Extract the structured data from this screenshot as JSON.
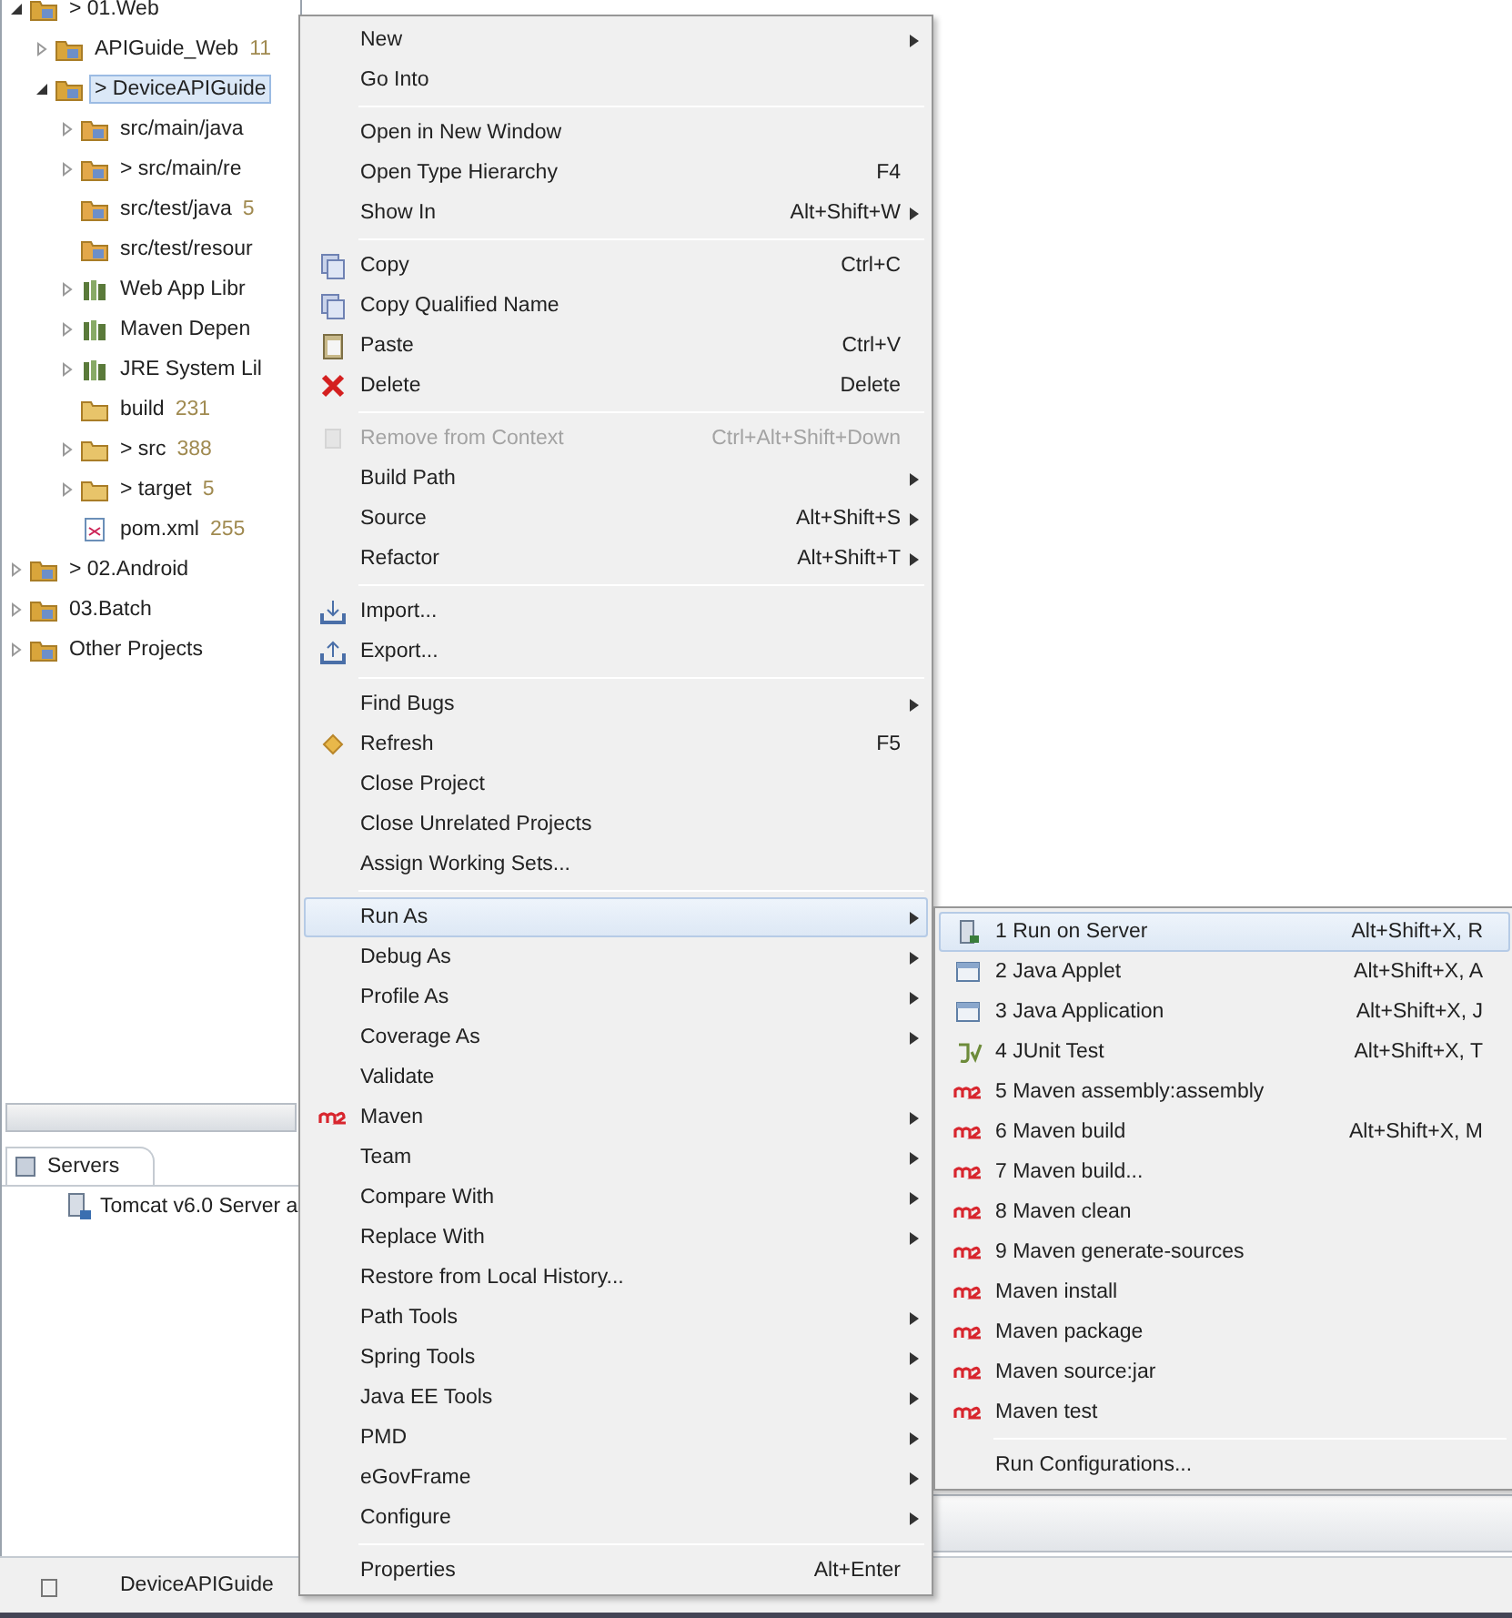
{
  "explorer": {
    "tree": [
      {
        "label": "> 01.Web",
        "kind": "working-set",
        "expanded": true,
        "selected": false,
        "children": [
          {
            "label": "APIGuide_Web",
            "count": "11",
            "kind": "project",
            "expanded": false,
            "selected": false
          },
          {
            "label": "> DeviceAPIGuide",
            "kind": "project",
            "expanded": true,
            "selected": true,
            "children": [
              {
                "label": "src/main/java",
                "kind": "source-folder",
                "expanded": false,
                "selected": false
              },
              {
                "label": "> src/main/re",
                "kind": "source-folder",
                "expanded": false,
                "selected": false
              },
              {
                "label": "src/test/java",
                "count": "5",
                "kind": "source-folder",
                "selected": false
              },
              {
                "label": "src/test/resour",
                "kind": "source-folder",
                "selected": false
              },
              {
                "label": "Web App Libr",
                "kind": "library",
                "expanded": false,
                "selected": false
              },
              {
                "label": "Maven Depen",
                "kind": "library",
                "expanded": false,
                "selected": false
              },
              {
                "label": "JRE System Lil",
                "kind": "library",
                "expanded": false,
                "selected": false
              },
              {
                "label": "build",
                "count": "231",
                "kind": "folder",
                "selected": false
              },
              {
                "label": "> src",
                "count": "388",
                "kind": "folder",
                "expanded": false,
                "selected": false
              },
              {
                "label": "> target",
                "count": "5",
                "kind": "folder",
                "expanded": false,
                "selected": false
              },
              {
                "label": "pom.xml",
                "count": "255",
                "kind": "file",
                "selected": false
              }
            ]
          }
        ]
      },
      {
        "label": "> 02.Android",
        "kind": "working-set",
        "expanded": false,
        "selected": false
      },
      {
        "label": "03.Batch",
        "kind": "working-set",
        "expanded": false,
        "selected": false
      },
      {
        "label": "Other Projects",
        "kind": "working-set",
        "expanded": false,
        "selected": false
      }
    ]
  },
  "servers_view": {
    "tab": "Servers",
    "items": [
      "Tomcat v6.0 Server a"
    ]
  },
  "status_bar": {
    "text": "DeviceAPIGuide"
  },
  "context_menu": {
    "groups": [
      [
        {
          "label": "New",
          "submenu": true,
          "selected": false,
          "disabled": false,
          "kind": "none"
        },
        {
          "label": "Go Into",
          "submenu": false,
          "selected": false,
          "disabled": false,
          "kind": "none"
        }
      ],
      [
        {
          "label": "Open in New Window",
          "submenu": false,
          "selected": false,
          "disabled": false,
          "kind": "none"
        },
        {
          "label": "Open Type Hierarchy",
          "shortcut": "F4",
          "submenu": false,
          "selected": false,
          "disabled": false,
          "kind": "none"
        },
        {
          "label": "Show In",
          "shortcut": "Alt+Shift+W",
          "submenu": true,
          "selected": false,
          "disabled": false,
          "kind": "none"
        }
      ],
      [
        {
          "label": "Copy",
          "shortcut": "Ctrl+C",
          "submenu": false,
          "selected": false,
          "disabled": false,
          "kind": "copy"
        },
        {
          "label": "Copy Qualified Name",
          "submenu": false,
          "selected": false,
          "disabled": false,
          "kind": "copy"
        },
        {
          "label": "Paste",
          "shortcut": "Ctrl+V",
          "submenu": false,
          "selected": false,
          "disabled": false,
          "kind": "paste"
        },
        {
          "label": "Delete",
          "shortcut": "Delete",
          "submenu": false,
          "selected": false,
          "disabled": false,
          "kind": "delete"
        }
      ],
      [
        {
          "label": "Remove from Context",
          "shortcut": "Ctrl+Alt+Shift+Down",
          "submenu": false,
          "selected": false,
          "disabled": true,
          "kind": "remove"
        },
        {
          "label": "Build Path",
          "submenu": true,
          "selected": false,
          "disabled": false,
          "kind": "none"
        },
        {
          "label": "Source",
          "shortcut": "Alt+Shift+S",
          "submenu": true,
          "selected": false,
          "disabled": false,
          "kind": "none"
        },
        {
          "label": "Refactor",
          "shortcut": "Alt+Shift+T",
          "submenu": true,
          "selected": false,
          "disabled": false,
          "kind": "none"
        }
      ],
      [
        {
          "label": "Import...",
          "submenu": false,
          "selected": false,
          "disabled": false,
          "kind": "import"
        },
        {
          "label": "Export...",
          "submenu": false,
          "selected": false,
          "disabled": false,
          "kind": "export"
        }
      ],
      [
        {
          "label": "Find Bugs",
          "submenu": true,
          "selected": false,
          "disabled": false,
          "kind": "none"
        },
        {
          "label": "Refresh",
          "shortcut": "F5",
          "submenu": false,
          "selected": false,
          "disabled": false,
          "kind": "refresh"
        },
        {
          "label": "Close Project",
          "submenu": false,
          "selected": false,
          "disabled": false,
          "kind": "none"
        },
        {
          "label": "Close Unrelated Projects",
          "submenu": false,
          "selected": false,
          "disabled": false,
          "kind": "none"
        },
        {
          "label": "Assign Working Sets...",
          "submenu": false,
          "selected": false,
          "disabled": false,
          "kind": "none"
        }
      ],
      [
        {
          "label": "Run As",
          "submenu": true,
          "selected": true,
          "disabled": false,
          "kind": "none"
        },
        {
          "label": "Debug As",
          "submenu": true,
          "selected": false,
          "disabled": false,
          "kind": "none"
        },
        {
          "label": "Profile As",
          "submenu": true,
          "selected": false,
          "disabled": false,
          "kind": "none"
        },
        {
          "label": "Coverage As",
          "submenu": true,
          "selected": false,
          "disabled": false,
          "kind": "none"
        },
        {
          "label": "Validate",
          "submenu": false,
          "selected": false,
          "disabled": false,
          "kind": "none"
        },
        {
          "label": "Maven",
          "submenu": true,
          "selected": false,
          "disabled": false,
          "kind": "maven"
        },
        {
          "label": "Team",
          "submenu": true,
          "selected": false,
          "disabled": false,
          "kind": "none"
        },
        {
          "label": "Compare With",
          "submenu": true,
          "selected": false,
          "disabled": false,
          "kind": "none"
        },
        {
          "label": "Replace With",
          "submenu": true,
          "selected": false,
          "disabled": false,
          "kind": "none"
        },
        {
          "label": "Restore from Local History...",
          "submenu": false,
          "selected": false,
          "disabled": false,
          "kind": "none"
        },
        {
          "label": "Path Tools",
          "submenu": true,
          "selected": false,
          "disabled": false,
          "kind": "none"
        },
        {
          "label": "Spring Tools",
          "submenu": true,
          "selected": false,
          "disabled": false,
          "kind": "none"
        },
        {
          "label": "Java EE Tools",
          "submenu": true,
          "selected": false,
          "disabled": false,
          "kind": "none"
        },
        {
          "label": "PMD",
          "submenu": true,
          "selected": false,
          "disabled": false,
          "kind": "none"
        },
        {
          "label": "eGovFrame",
          "submenu": true,
          "selected": false,
          "disabled": false,
          "kind": "none"
        },
        {
          "label": "Configure",
          "submenu": true,
          "selected": false,
          "disabled": false,
          "kind": "none"
        }
      ],
      [
        {
          "label": "Properties",
          "shortcut": "Alt+Enter",
          "submenu": false,
          "selected": false,
          "disabled": false,
          "kind": "none"
        }
      ]
    ]
  },
  "run_as_submenu": {
    "groups": [
      [
        {
          "label": "1 Run on Server",
          "shortcut": "Alt+Shift+X, R",
          "selected": true,
          "kind": "server"
        },
        {
          "label": "2 Java Applet",
          "shortcut": "Alt+Shift+X, A",
          "selected": false,
          "kind": "applet"
        },
        {
          "label": "3 Java Application",
          "shortcut": "Alt+Shift+X, J",
          "selected": false,
          "kind": "application"
        },
        {
          "label": "4 JUnit Test",
          "shortcut": "Alt+Shift+X, T",
          "selected": false,
          "kind": "junit"
        },
        {
          "label": "5 Maven assembly:assembly",
          "selected": false,
          "kind": "maven"
        },
        {
          "label": "6 Maven build",
          "shortcut": "Alt+Shift+X, M",
          "selected": false,
          "kind": "maven"
        },
        {
          "label": "7 Maven build...",
          "selected": false,
          "kind": "maven"
        },
        {
          "label": "8 Maven clean",
          "selected": false,
          "kind": "maven"
        },
        {
          "label": "9 Maven generate-sources",
          "selected": false,
          "kind": "maven"
        },
        {
          "label": "Maven install",
          "selected": false,
          "kind": "maven"
        },
        {
          "label": "Maven package",
          "selected": false,
          "kind": "maven"
        },
        {
          "label": "Maven source:jar",
          "selected": false,
          "kind": "maven"
        },
        {
          "label": "Maven test",
          "selected": false,
          "kind": "maven"
        }
      ],
      [
        {
          "label": "Run Configurations...",
          "selected": false,
          "kind": "none"
        }
      ]
    ]
  }
}
